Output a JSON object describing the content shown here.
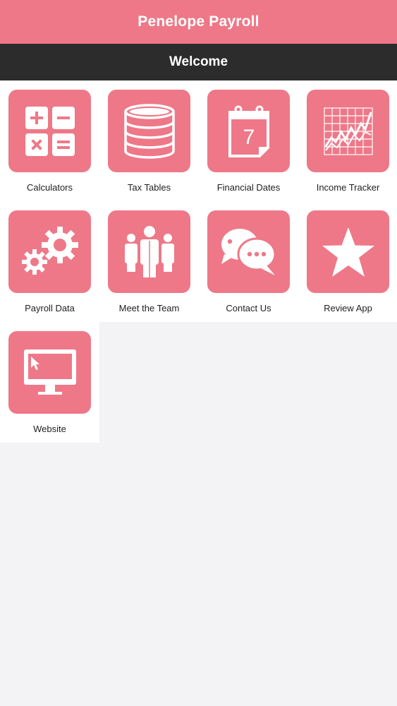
{
  "app": {
    "title": "Penelope Payroll"
  },
  "header": {
    "subtitle": "Welcome"
  },
  "menu": {
    "items": [
      {
        "label": "Calculators",
        "icon": "calculator-icon"
      },
      {
        "label": "Tax Tables",
        "icon": "database-stack-icon"
      },
      {
        "label": "Financial Dates",
        "icon": "calendar-icon"
      },
      {
        "label": "Income Tracker",
        "icon": "line-chart-icon"
      },
      {
        "label": "Payroll Data",
        "icon": "gears-icon"
      },
      {
        "label": "Meet the Team",
        "icon": "team-icon"
      },
      {
        "label": "Contact Us",
        "icon": "chat-bubbles-icon"
      },
      {
        "label": "Review App",
        "icon": "star-icon"
      },
      {
        "label": "Website",
        "icon": "monitor-icon"
      }
    ]
  },
  "calendar_icon_day": "7",
  "colors": {
    "primary": "#ee7888",
    "dark_bar": "#2c2c2c",
    "background": "#f3f2f4"
  }
}
